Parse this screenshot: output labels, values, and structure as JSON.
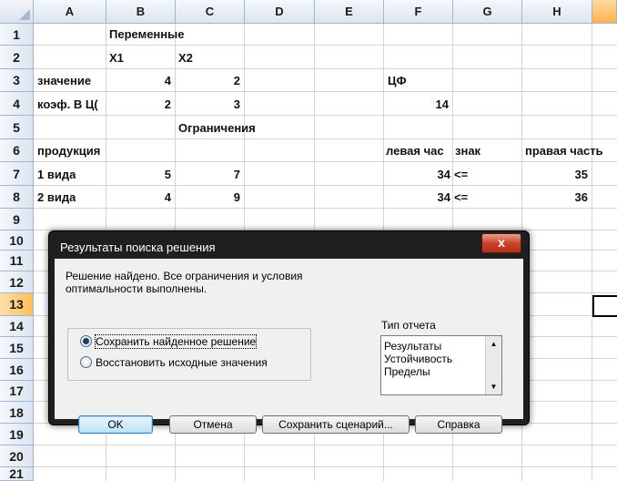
{
  "columns": [
    "A",
    "B",
    "C",
    "D",
    "E",
    "F",
    "G",
    "H",
    ""
  ],
  "rows": [
    "1",
    "2",
    "3",
    "4",
    "5",
    "6",
    "7",
    "8",
    "9",
    "10",
    "11",
    "12",
    "13",
    "14",
    "15",
    "16",
    "17",
    "18",
    "19",
    "20",
    "21"
  ],
  "cells": {
    "b1": "Переменные",
    "b2": "X1",
    "c2": "X2",
    "a3": "значение",
    "b3": "4",
    "c3": "2",
    "f3": "ЦФ",
    "a4": "коэф. В Ц(",
    "b4": "2",
    "c4": "3",
    "f4": "14",
    "c5": "Ограничения",
    "a6": "продукция",
    "f6": "левая час",
    "g6": "знак",
    "h6": "правая часть",
    "a7": "1 вида",
    "b7": "5",
    "c7": "7",
    "f7": "34",
    "g7": "<=",
    "h7": "35",
    "a8": "2 вида",
    "b8": "4",
    "c8": "9",
    "f8": "34",
    "g8": "<=",
    "h8": "36"
  },
  "dialog": {
    "title": "Результаты поиска решения",
    "close": "x",
    "message_line1": "Решение найдено. Все ограничения и условия",
    "message_line2": "оптимальности выполнены.",
    "radio_keep": "Сохранить найденное решение",
    "radio_restore": "Восстановить исходные значения",
    "report_type_label": "Тип отчета",
    "report_types": [
      "Результаты",
      "Устойчивость",
      "Пределы"
    ],
    "btn_ok": "OK",
    "btn_cancel": "Отмена",
    "btn_save_scenario": "Сохранить сценарий...",
    "btn_help": "Справка"
  },
  "colors": {
    "header_bg": "#dbe4f0",
    "selected_header": "#ffb34d",
    "dialog_frame": "#1f1f1f",
    "close_button": "#c8452b"
  }
}
